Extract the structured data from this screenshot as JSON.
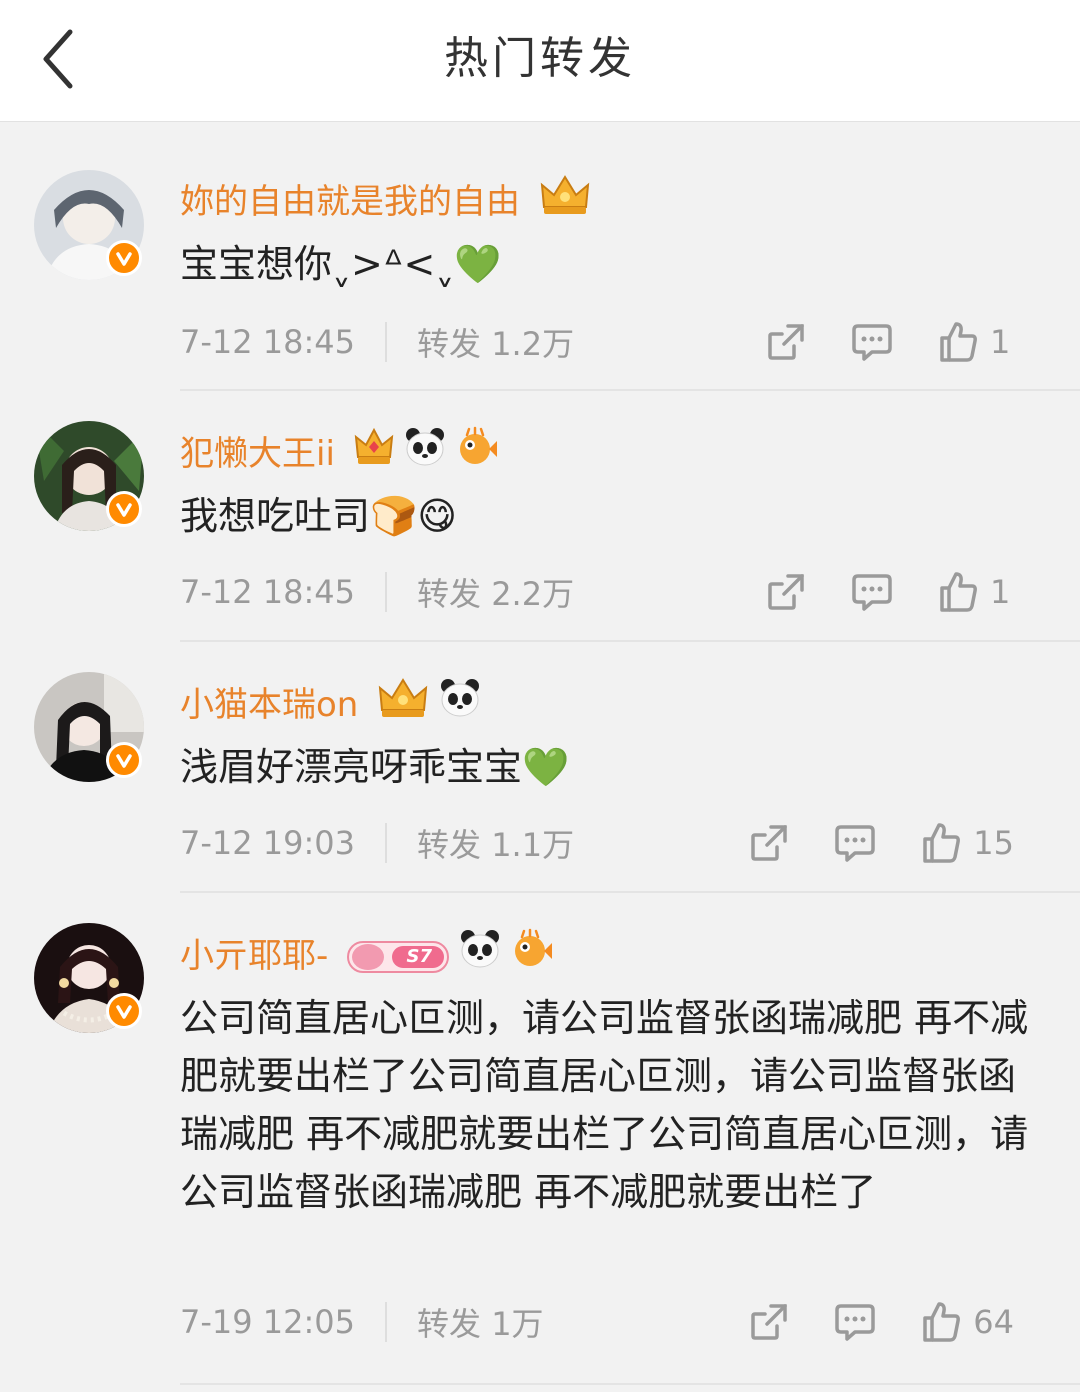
{
  "header": {
    "title": "热门转发",
    "back_icon": "chevron-left-icon"
  },
  "colors": {
    "username": "#e8832b",
    "verified_badge": "#ff8a00",
    "meta_text": "#9a9a9a",
    "background": "#f2f2f2",
    "header_background": "#ffffff"
  },
  "posts": [
    {
      "username": "妳的自由就是我的自由",
      "badges": [
        "crown-badge-icon"
      ],
      "content": "宝宝想你ˬ>ᐞ<ˬ💚",
      "time": "7-12 18:45",
      "repost": "转发 1.2万",
      "likes": "1"
    },
    {
      "username": "犯懒大王ii",
      "badges": [
        "crown-badge-icon",
        "panda-badge-icon",
        "pufferfish-badge-icon"
      ],
      "content": "我想吃吐司🍞😋",
      "time": "7-12 18:45",
      "repost": "转发 2.2万",
      "likes": "1"
    },
    {
      "username": "小猫本瑞on",
      "badges": [
        "crown-badge-icon",
        "panda-badge-icon"
      ],
      "content": "浅眉好漂亮呀乖宝宝💚",
      "time": "7-12 19:03",
      "repost": "转发 1.1万",
      "likes": "15"
    },
    {
      "username": "小亓耶耶-",
      "badges": [
        "s7-membership-badge-icon",
        "panda-badge-icon",
        "pufferfish-badge-icon"
      ],
      "s7_text": "S7",
      "content": "公司简直居心叵测，请公司监督张函瑞减肥 再不减肥就要出栏了公司简直居心叵测，请公司监督张函瑞减肥 再不减肥就要出栏了公司简直居心叵测，请公司监督张函瑞减肥 再不减肥就要出栏了",
      "time": "7-19 12:05",
      "repost": "转发 1万",
      "likes": "64"
    }
  ]
}
